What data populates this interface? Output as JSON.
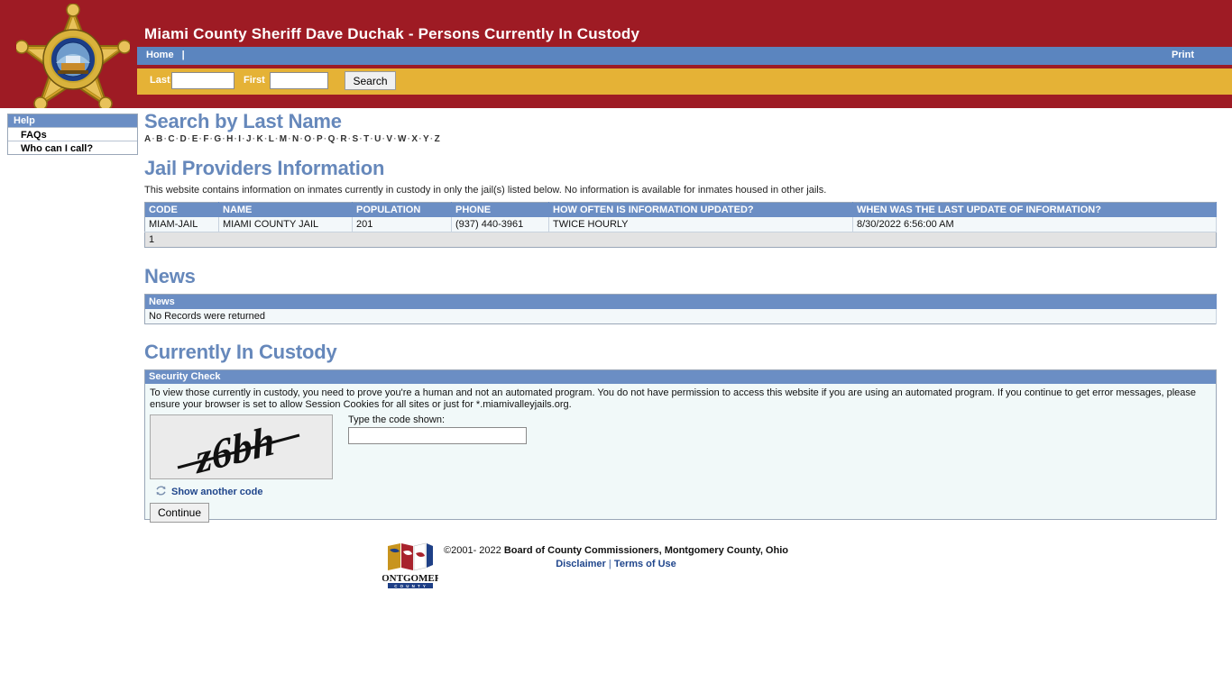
{
  "header": {
    "title": "Miami County Sheriff Dave Duchak - Persons Currently In Custody",
    "badge_alt": "sheriff-star-badge",
    "nav": {
      "home_label": "Home",
      "separator": "|",
      "print_label": "Print"
    },
    "search": {
      "last_label": "Last",
      "last_value": "",
      "first_label": "First",
      "first_value": "",
      "button_label": "Search"
    }
  },
  "sidebar": {
    "heading": "Help",
    "items": [
      {
        "label": "FAQs"
      },
      {
        "label": "Who can I call?"
      }
    ]
  },
  "search_by_last_name": {
    "title": "Search by Last Name",
    "letters": [
      "A",
      "B",
      "C",
      "D",
      "E",
      "F",
      "G",
      "H",
      "I",
      "J",
      "K",
      "L",
      "M",
      "N",
      "O",
      "P",
      "Q",
      "R",
      "S",
      "T",
      "U",
      "V",
      "W",
      "X",
      "Y",
      "Z"
    ],
    "separator": "·"
  },
  "jail_providers": {
    "title": "Jail Providers Information",
    "description": "This website contains information on inmates currently in custody in only the jail(s) listed below. No information is available for inmates housed in other jails.",
    "columns": [
      "CODE",
      "NAME",
      "POPULATION",
      "PHONE",
      "HOW OFTEN IS INFORMATION UPDATED?",
      "WHEN WAS THE LAST UPDATE OF INFORMATION?"
    ],
    "rows": [
      {
        "code": "MIAM-JAIL",
        "name": "MIAMI COUNTY JAIL",
        "population": "201",
        "phone": "(937) 440-3961",
        "frequency": "TWICE HOURLY",
        "last_update": "8/30/2022 6:56:00 AM"
      }
    ],
    "footer_page": "1"
  },
  "news": {
    "title": "News",
    "column": "News",
    "empty_message": "No Records were returned"
  },
  "currently_in_custody": {
    "title": "Currently In Custody",
    "security": {
      "heading": "Security Check",
      "paragraph": "To view those currently in custody, you need to prove you're a human and not an automated program. You do not have permission to access this website if you are using an automated program. If you continue to get error messages, please ensure your browser is set to allow Session Cookies for all sites or just for *.miamivalleyjails.org.",
      "captcha_text": "z6bh",
      "type_code_label": "Type the code shown:",
      "code_value": "",
      "another_code_label": "Show another code",
      "continue_label": "Continue"
    }
  },
  "footer": {
    "copyright_prefix": "©2001- 2022 ",
    "copyright_org": "Board of County Commissioners, Montgomery County, Ohio",
    "disclaimer_label": "Disclaimer",
    "links_separator": "|",
    "terms_label": "Terms of Use",
    "logo_text": "MONTGOMERY",
    "logo_subtext": "C O U N T Y"
  },
  "colors": {
    "header_red": "#9e1b24",
    "nav_blue": "#5b85bf",
    "search_gold": "#e5b236",
    "table_header_blue": "#6b8ec4",
    "heading_blue": "#6688bb",
    "link_blue": "#20468c"
  }
}
